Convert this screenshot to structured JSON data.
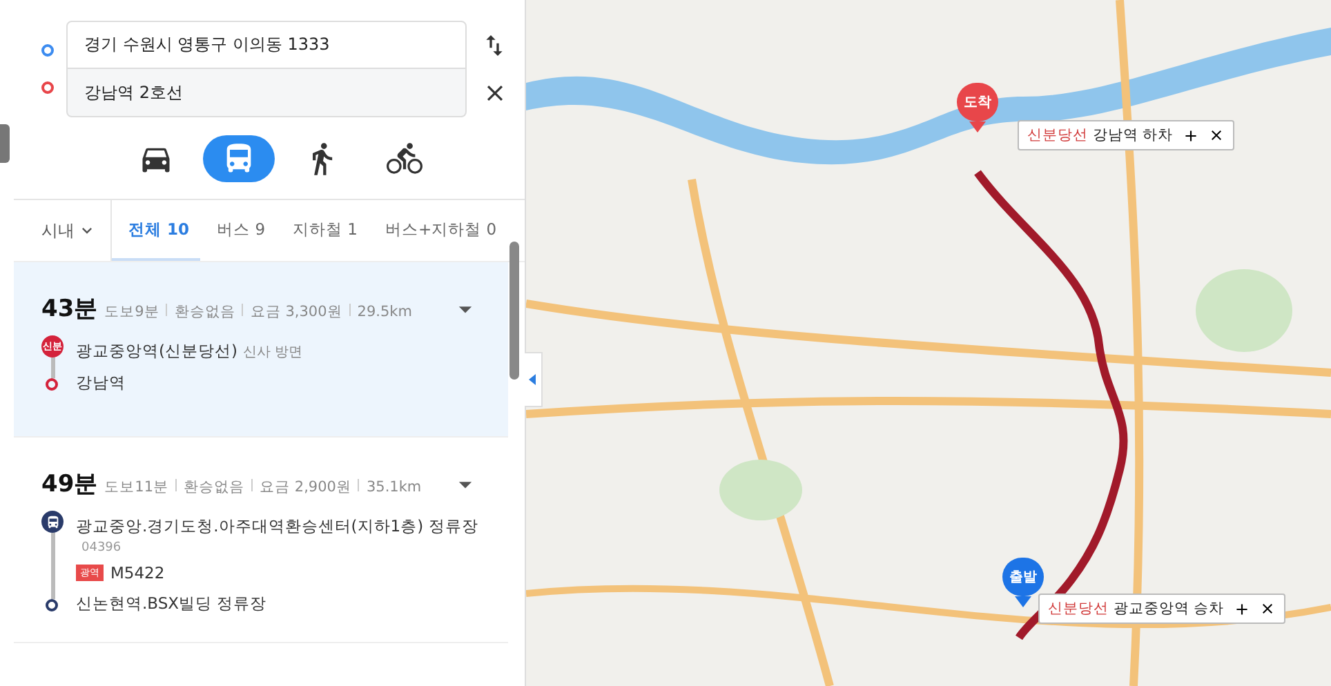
{
  "search": {
    "origin": {
      "value": "경기 수원시 영통구 이의동 1333"
    },
    "destination": {
      "value": "강남역 2호선"
    }
  },
  "modes": [
    {
      "kind": "car",
      "selected": false
    },
    {
      "kind": "bus",
      "selected": true
    },
    {
      "kind": "walk",
      "selected": false
    },
    {
      "kind": "bike",
      "selected": false
    }
  ],
  "filter": {
    "region": "시내"
  },
  "tabs": [
    {
      "label": "전체",
      "count": "10",
      "selected": true
    },
    {
      "label": "버스",
      "count": "9",
      "selected": false
    },
    {
      "label": "지하철",
      "count": "1",
      "selected": false
    },
    {
      "label": "버스+지하철",
      "count": "0",
      "selected": false
    }
  ],
  "routes": [
    {
      "duration": "43분",
      "summary": [
        "도보9분",
        "환승없음",
        "요금 3,300원",
        "29.5km"
      ],
      "selected": true,
      "steps": [
        {
          "kind": "subway",
          "badge": "신분",
          "name": "광교중앙역(신분당선)",
          "direction": "신사 방면"
        },
        {
          "kind": "end",
          "name": "강남역"
        }
      ]
    },
    {
      "duration": "49분",
      "summary": [
        "도보11분",
        "환승없음",
        "요금 2,900원",
        "35.1km"
      ],
      "selected": false,
      "steps": [
        {
          "kind": "bus",
          "name": "광교중앙.경기도청.아주대역환승센터(지하1층) 정류장",
          "stop_id": "04396",
          "line_badge": "광역",
          "line_number": "M5422"
        },
        {
          "kind": "end",
          "name": "신논현역.BSX빌딩 정류장"
        }
      ]
    }
  ],
  "map": {
    "markers": [
      {
        "kind": "arrival",
        "label": "도착",
        "line": "신분당선",
        "text": "강남역 하차"
      },
      {
        "kind": "departure",
        "label": "출발",
        "line": "신분당선",
        "text": "광교중앙역 승차"
      }
    ]
  }
}
